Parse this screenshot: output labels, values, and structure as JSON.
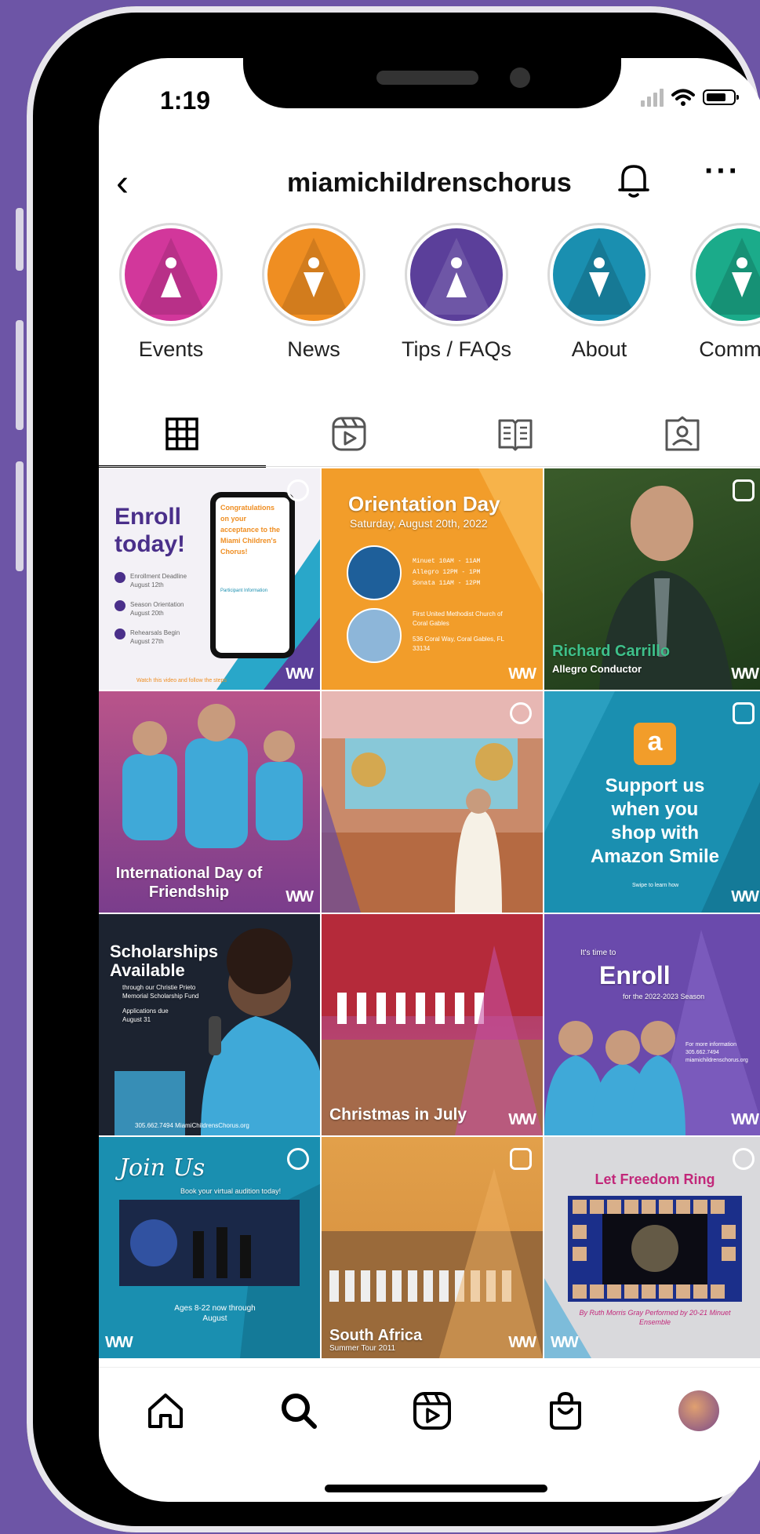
{
  "status_bar": {
    "time": "1:19"
  },
  "header": {
    "username": "miamichildrenschorus"
  },
  "highlights": [
    {
      "label": "Events",
      "color": "#d2379b"
    },
    {
      "label": "News",
      "color": "#ef8e22"
    },
    {
      "label": "Tips / FAQs",
      "color": "#5b3f9a"
    },
    {
      "label": "About",
      "color": "#1a8fb0"
    },
    {
      "label": "Commun",
      "color": "#1bab8a"
    }
  ],
  "tabs": [
    "grid-icon",
    "reels-icon",
    "guides-icon",
    "tagged-icon"
  ],
  "posts": [
    {
      "title": "Enroll today!",
      "lines": [
        "Enrollment Deadline August 12th",
        "Season Orientation August 20th",
        "Rehearsals Begin August 27th"
      ],
      "phone_text": "Congratulations on your acceptance to the Miami Children's Chorus!",
      "phone_sub": "Participant Information",
      "footer": "Watch this video and follow the steps"
    },
    {
      "title": "Orientation Day",
      "subtitle": "Saturday, August 20th, 2022",
      "times": [
        "Minuet  10AM - 11AM",
        "Allegro  12PM - 1PM",
        "Sonata  11AM - 12PM"
      ],
      "venue": "First United Methodist Church of Coral Gables",
      "address": "536 Coral Way, Coral Gables, FL 33134"
    },
    {
      "name": "Richard Carrillo",
      "role": "Allegro Conductor"
    },
    {
      "title": "International Day of Friendship"
    },
    {
      "title": ""
    },
    {
      "lines": [
        "Support us",
        "when you",
        "shop with",
        "Amazon Smile"
      ],
      "note": "Swipe to learn how"
    },
    {
      "title": "Scholarships Available",
      "sub": "through our Christie Prieto Memorial Scholarship Fund",
      "sub2": "Applications due August 31",
      "contact": "305.662.7494  MiamiChildrensChorus.org"
    },
    {
      "title": "Christmas in July"
    },
    {
      "pre": "It's time to",
      "title": "Enroll",
      "sub": "for the 2022-2023 Season",
      "info": "For more information 305.662.7494 miamichildrenschorus.org"
    },
    {
      "title": "Join Us",
      "sub": "Book your virtual audition today!",
      "footer": "Ages 8-22 now through August"
    },
    {
      "title": "South Africa",
      "sub": "Summer Tour 2011"
    },
    {
      "title": "Let Freedom Ring",
      "sub": "By Ruth Morris Gray Performed by 20-21 Minuet Ensemble"
    }
  ]
}
